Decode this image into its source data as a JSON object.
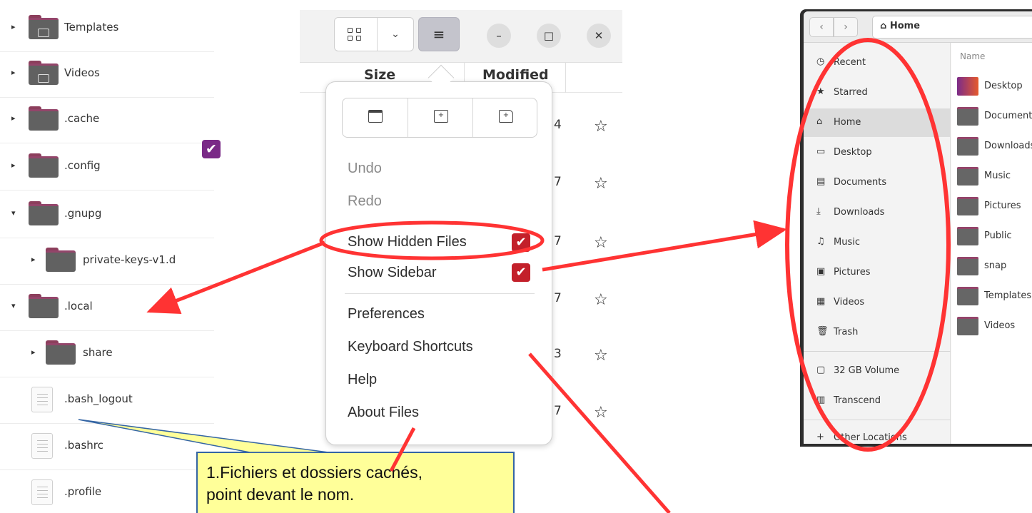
{
  "tree": {
    "items": [
      {
        "name": "Templates",
        "expander": "▸",
        "kind": "folder",
        "emblem": "template"
      },
      {
        "name": "Videos",
        "expander": "▸",
        "kind": "folder",
        "emblem": "video"
      },
      {
        "name": ".cache",
        "expander": "▸",
        "kind": "folder"
      },
      {
        "name": ".config",
        "expander": "▸",
        "kind": "folder"
      },
      {
        "name": ".gnupg",
        "expander": "▾",
        "kind": "folder"
      },
      {
        "name": "private-keys-v1.d",
        "expander": "▸",
        "kind": "folder"
      },
      {
        "name": ".local",
        "expander": "▾",
        "kind": "folder"
      },
      {
        "name": "share",
        "expander": "▸",
        "kind": "folder"
      },
      {
        "name": ".bash_logout",
        "kind": "file"
      },
      {
        "name": ".bashrc",
        "kind": "file"
      },
      {
        "name": ".profile",
        "kind": "file"
      }
    ],
    "check_mark": "✔"
  },
  "middle": {
    "view_chevron": "⌄",
    "menu_icon": "≡",
    "minimize": "–",
    "maximize": "□",
    "close": "✕",
    "header": {
      "col_size": "Size",
      "col_modified": "Modified"
    },
    "fragments": [
      "4",
      "7",
      "7",
      "7",
      "3",
      "7"
    ],
    "star": "☆"
  },
  "popover": {
    "actions": [
      "new-window",
      "new-tab",
      "new-folder"
    ],
    "items": {
      "undo": "Undo",
      "redo": "Redo",
      "show_hidden": "Show Hidden Files",
      "show_sidebar": "Show Sidebar",
      "preferences": "Preferences",
      "shortcuts": "Keyboard Shortcuts",
      "help": "Help",
      "about": "About Files"
    },
    "check": "✔"
  },
  "right": {
    "back": "‹",
    "forward": "›",
    "path": "⌂ Home",
    "name_header": "Name",
    "sidebar": [
      {
        "icon": "◷",
        "label": "Recent"
      },
      {
        "icon": "★",
        "label": "Starred"
      },
      {
        "icon": "⌂",
        "label": "Home"
      },
      {
        "icon": "▭",
        "label": "Desktop"
      },
      {
        "icon": "▤",
        "label": "Documents"
      },
      {
        "icon": "⤓",
        "label": "Downloads"
      },
      {
        "icon": "♫",
        "label": "Music"
      },
      {
        "icon": "▣",
        "label": "Pictures"
      },
      {
        "icon": "▦",
        "label": "Videos"
      },
      {
        "icon": "🗑",
        "label": "Trash"
      },
      {
        "icon": "▢",
        "label": "32 GB Volume"
      },
      {
        "icon": "▥",
        "label": "Transcend"
      },
      {
        "icon": "+",
        "label": "Other Locations"
      }
    ],
    "files": [
      "Desktop",
      "Documents",
      "Downloads",
      "Music",
      "Pictures",
      "Public",
      "snap",
      "Templates",
      "Videos"
    ]
  },
  "callout": {
    "line1": "1.Fichiers et dossiers cachés,",
    "line2": "point devant le nom."
  },
  "colors": {
    "annotation_red": "#ff3333",
    "check_red": "#c3202a",
    "check_purple": "#7a2a87",
    "callout_fill": "#ffff99"
  }
}
